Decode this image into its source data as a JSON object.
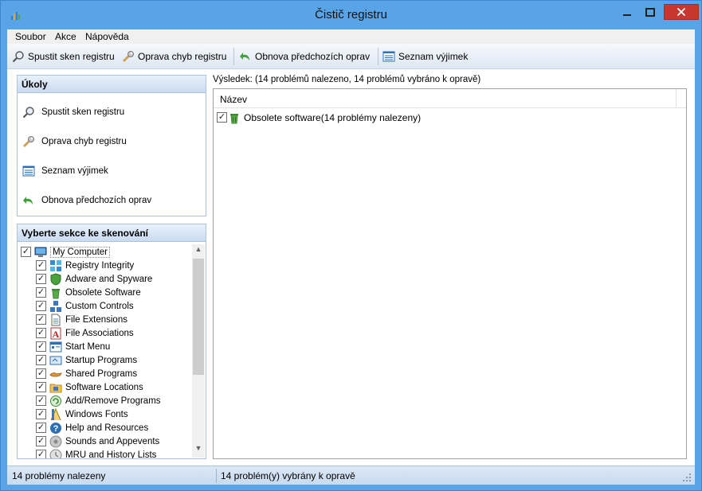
{
  "window": {
    "title": "Čistič registru"
  },
  "menu": {
    "items": [
      "Soubor",
      "Akce",
      "Nápověda"
    ]
  },
  "toolbar": {
    "scan_label": "Spustit sken registru",
    "repair_label": "Oprava chyb registru",
    "restore_label": "Obnova předchozích oprav",
    "exclusions_label": "Seznam výjimek"
  },
  "tasks": {
    "header": "Úkoly",
    "scan": "Spustit sken registru",
    "repair": "Oprava chyb registru",
    "exclusions": "Seznam výjimek",
    "restore": "Obnova předchozích oprav"
  },
  "sections": {
    "header": "Vyberte sekce ke skenování",
    "root": "My Computer",
    "items": [
      "Registry Integrity",
      "Adware and Spyware",
      "Obsolete Software",
      "Custom Controls",
      "File Extensions",
      "File Associations",
      "Start Menu",
      "Startup Programs",
      "Shared Programs",
      "Software Locations",
      "Add/Remove Programs",
      "Windows Fonts",
      "Help and Resources",
      "Sounds and Appevents",
      "MRU and History Lists"
    ]
  },
  "results": {
    "summary": "Výsledek: (14 problémů nalezeno, 14 problémů vybráno k opravě)",
    "column": "Název",
    "rows": [
      "Obsolete software(14 problémy nalezeny)"
    ]
  },
  "status": {
    "found": "14 problémy nalezeny",
    "selected": "14 problém(y) vybrány k opravě"
  },
  "colors": {
    "title_bar": "#58a4e6",
    "close_button": "#c7372f",
    "panel_header": "#c9dcf0"
  }
}
